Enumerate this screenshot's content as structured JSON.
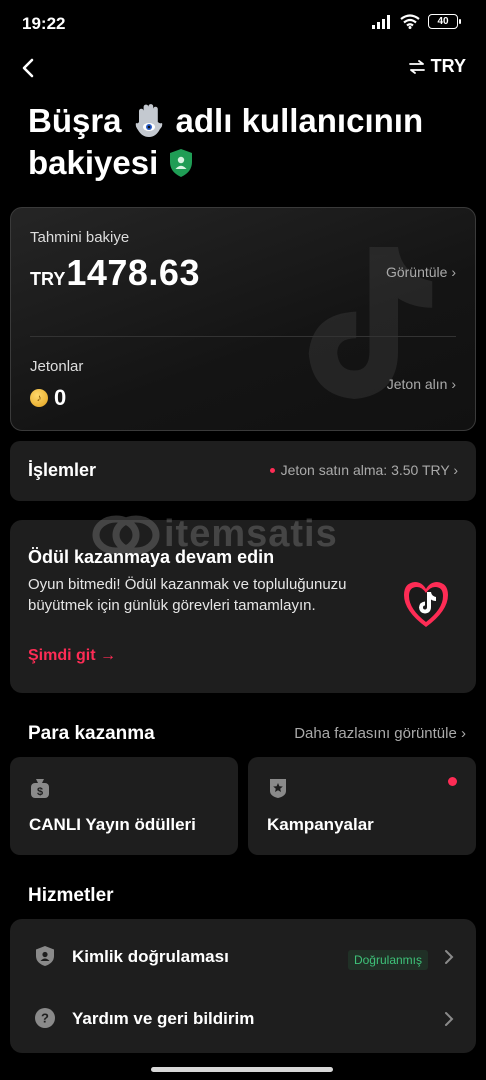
{
  "status_bar": {
    "time": "19:22",
    "battery": "40"
  },
  "nav": {
    "currency": "TRY"
  },
  "title": {
    "line1_pre": "Büşra",
    "line1_post": "adlı kullanıcının",
    "line2": "bakiyesi"
  },
  "balance": {
    "label": "Tahmini bakiye",
    "currency": "TRY",
    "amount": "1478.63",
    "view_link": "Görüntüle ›",
    "coins_label": "Jetonlar",
    "coins_value": "0",
    "get_coins_link": "Jeton alın ›"
  },
  "transactions": {
    "title": "İşlemler",
    "info": "Jeton satın alma: 3.50 TRY ›"
  },
  "reward": {
    "title": "Ödül kazanmaya devam edin",
    "text": "Oyun bitmedi! Ödül kazanmak ve topluluğunuzu büyütmek için günlük görevleri tamamlayın.",
    "link": "Şimdi git →"
  },
  "watermark": "itemsatis",
  "earn": {
    "title": "Para kazanma",
    "more_link": "Daha fazlasını görüntüle ›",
    "tiles": [
      {
        "label": "CANLI Yayın ödülleri"
      },
      {
        "label": "Kampanyalar"
      }
    ]
  },
  "services": {
    "title": "Hizmetler",
    "items": [
      {
        "label": "Kimlik doğrulaması",
        "badge": "Doğrulanmış"
      },
      {
        "label": "Yardım ve geri bildirim"
      }
    ]
  },
  "colors": {
    "accent": "#fe2c55",
    "verified": "#3ec279",
    "card": "#1e1e1e"
  }
}
